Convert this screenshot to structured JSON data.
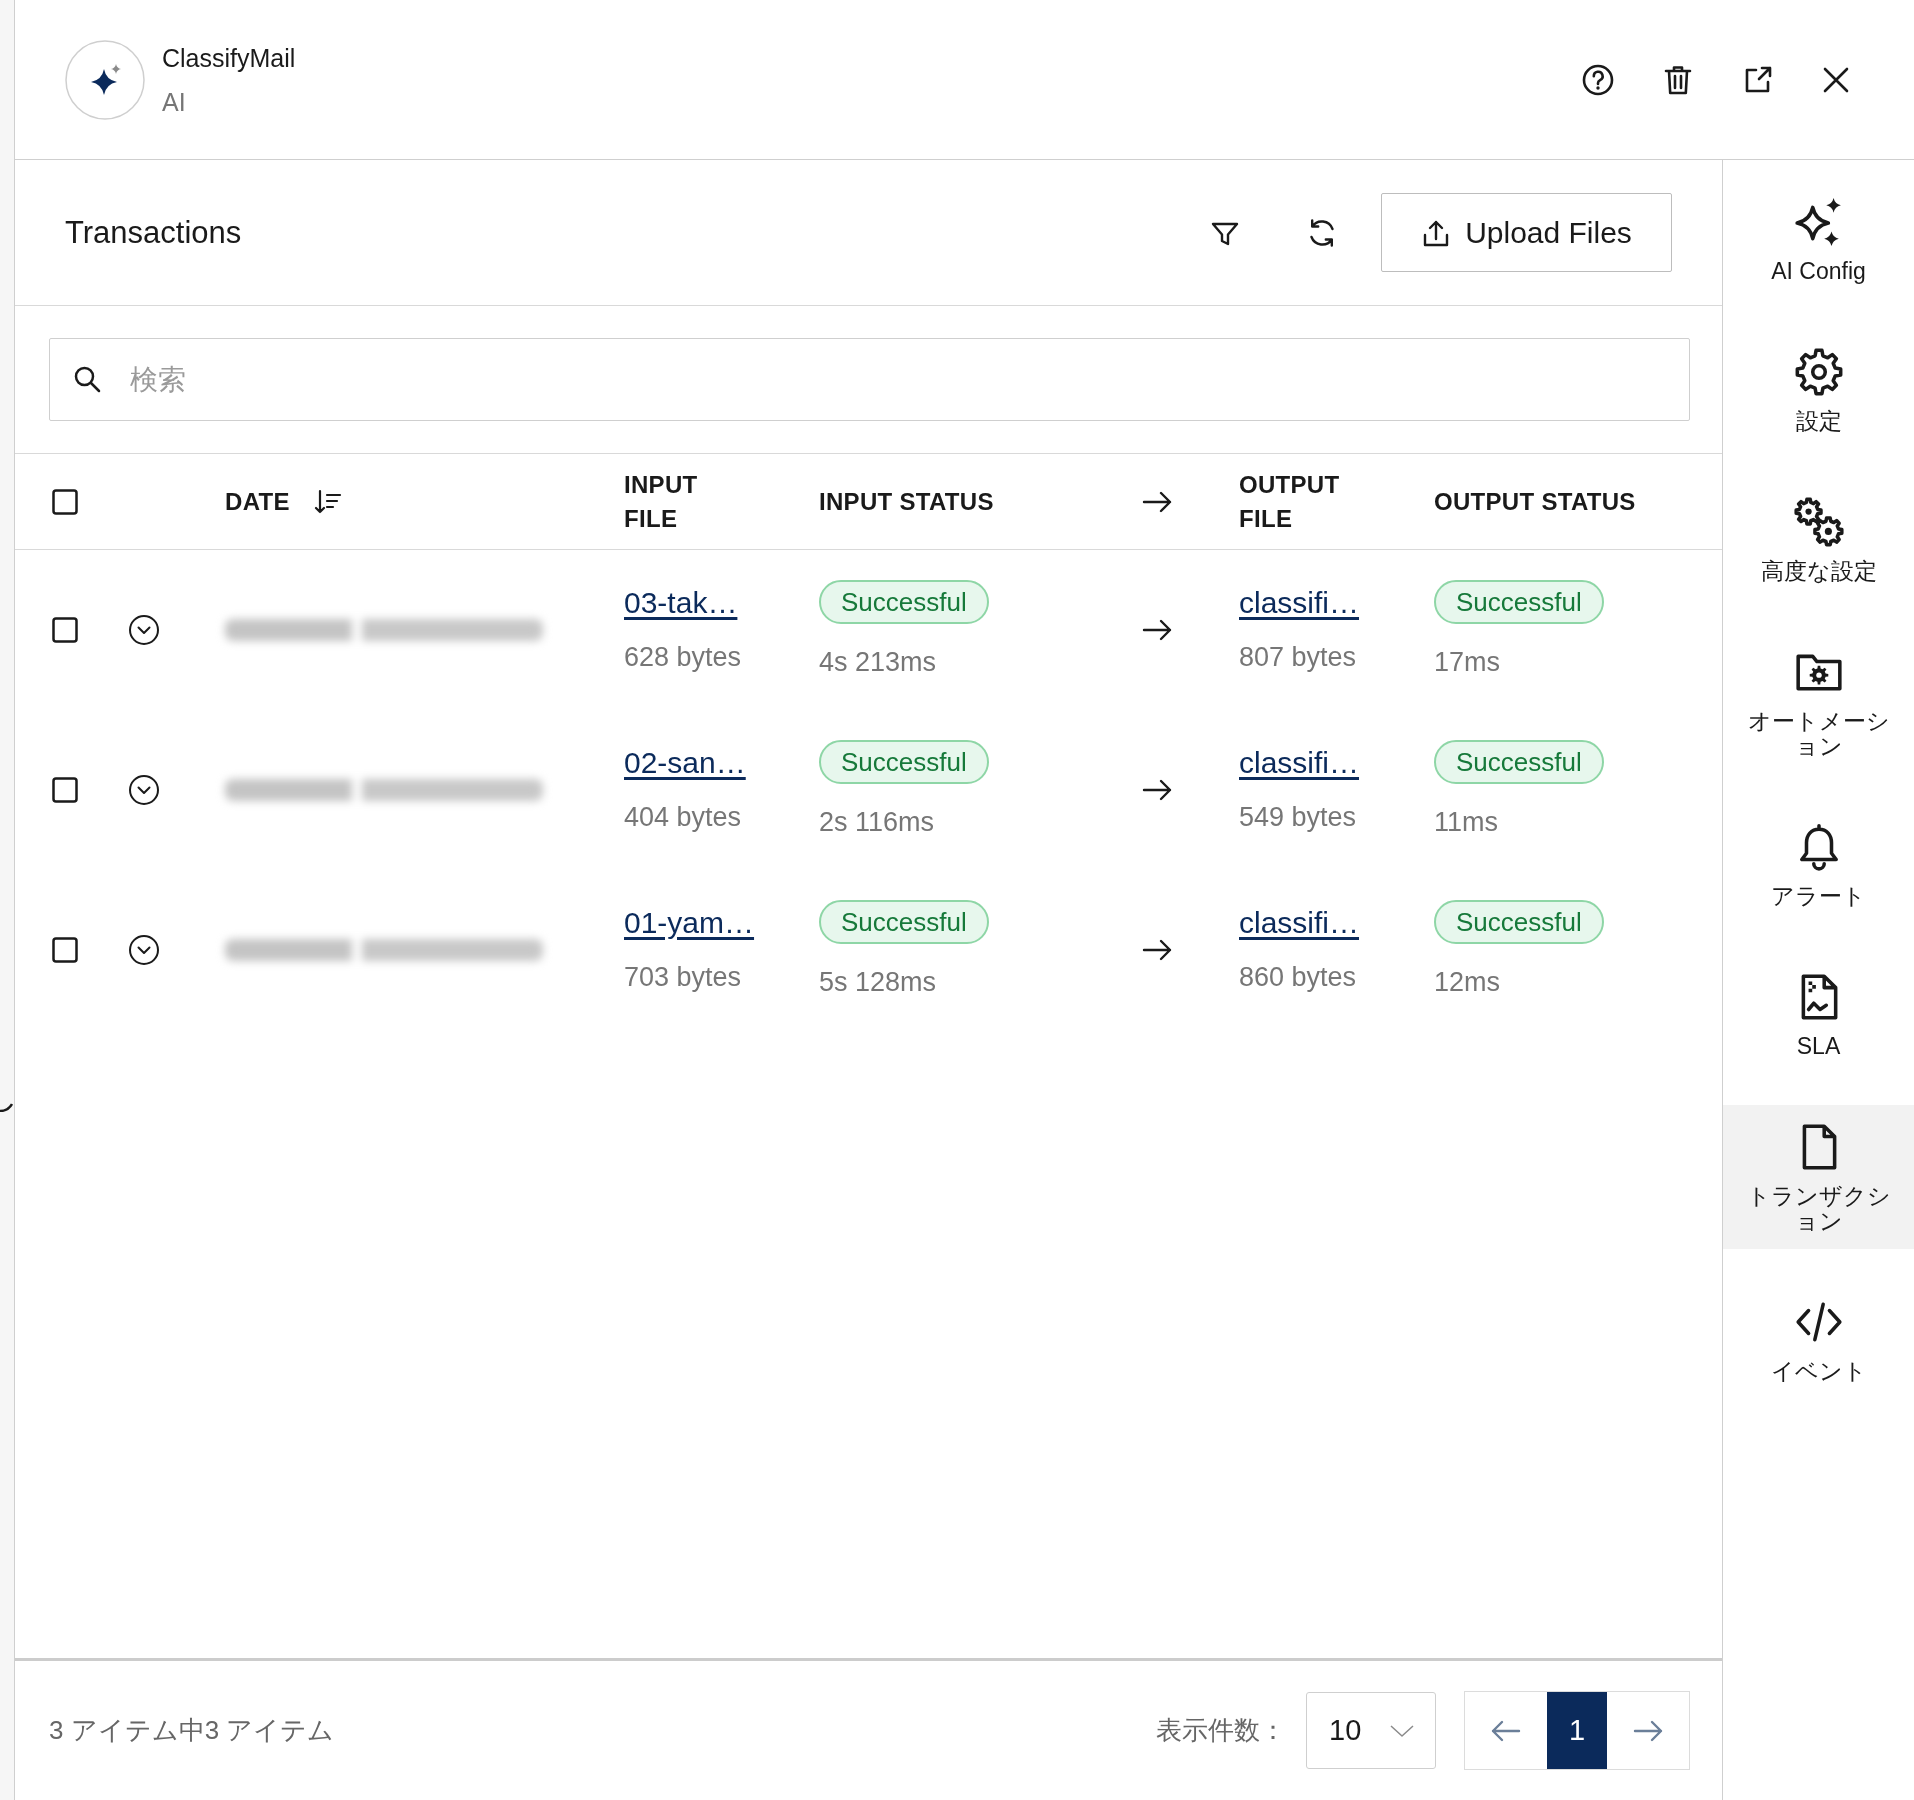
{
  "app": {
    "title": "ClassifyMail",
    "subtitle": "AI"
  },
  "toolbar": {
    "title": "Transactions",
    "upload_button": "Upload Files"
  },
  "search": {
    "placeholder": "検索"
  },
  "table": {
    "select_all": {
      "checked": false
    },
    "columns": [
      {
        "label": "DATE",
        "kind": "date",
        "sorted": true
      },
      {
        "label": "INPUT FILE",
        "kind": "file",
        "sorted": false
      },
      {
        "label": "INPUT STATUS",
        "kind": "status",
        "sorted": false
      },
      {
        "label": "OUTPUT FILE",
        "kind": "file",
        "sorted": false
      },
      {
        "label": "OUTPUT STATUS",
        "kind": "status",
        "sorted": false
      }
    ],
    "rows": [
      {
        "checked": false,
        "expanded": false,
        "input_file": {
          "name": "03-tak…",
          "size": "628 bytes"
        },
        "input_status": {
          "label": "Successful",
          "duration": "4s 213ms"
        },
        "output_file": {
          "name": "classifi…",
          "size": "807 bytes"
        },
        "output_status": {
          "label": "Successful",
          "duration": "17ms"
        }
      },
      {
        "checked": false,
        "expanded": false,
        "input_file": {
          "name": "02-san…",
          "size": "404 bytes"
        },
        "input_status": {
          "label": "Successful",
          "duration": "2s 116ms"
        },
        "output_file": {
          "name": "classifi…",
          "size": "549 bytes"
        },
        "output_status": {
          "label": "Successful",
          "duration": "11ms"
        }
      },
      {
        "checked": false,
        "expanded": false,
        "input_file": {
          "name": "01-yam…",
          "size": "703 bytes"
        },
        "input_status": {
          "label": "Successful",
          "duration": "5s 128ms"
        },
        "output_file": {
          "name": "classifi…",
          "size": "860 bytes"
        },
        "output_status": {
          "label": "Successful",
          "duration": "12ms"
        }
      }
    ]
  },
  "footer": {
    "summary": "3 アイテム中3 アイテム",
    "page_size_label": "表示件数：",
    "page_size": "10",
    "pages": [
      {
        "label": "1",
        "selected": true
      }
    ]
  },
  "sidebar": {
    "items": [
      {
        "label": "AI Config",
        "selected": false
      },
      {
        "label": "設定",
        "selected": false
      },
      {
        "label": "高度な設定",
        "selected": false
      },
      {
        "label": "オートメーション",
        "selected": false
      },
      {
        "label": "アラート",
        "selected": false
      },
      {
        "label": "SLA",
        "selected": false
      },
      {
        "label": "トランザクション",
        "selected": true
      },
      {
        "label": "イベント",
        "selected": false
      }
    ]
  }
}
